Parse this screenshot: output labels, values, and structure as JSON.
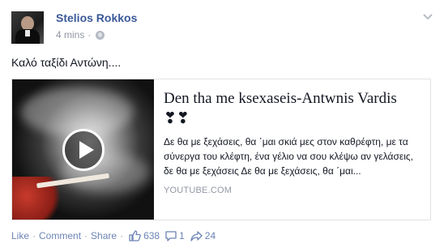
{
  "post": {
    "author": "Stelios Rokkos",
    "timestamp": "4 mins",
    "separator": "·",
    "privacy_icon": "globe-icon",
    "message": "Καλό ταξίδι Αντώνη....",
    "share": {
      "title": "Den tha me ksexaseis-Antwnis Vardis ❣❣",
      "description": "Δε θα με ξεχάσεις, θα ΄μαι σκιά μες στον καθρέφτη, με τα σύνεργα του κλέφτη, ένα γέλιο να σου κλέψω αν γελάσεις, δε θα με ξεχάσεις Δε θα με ξεχάσεις, θα ΄μαι...",
      "source": "YOUTUBE.COM"
    },
    "actions": {
      "like": "Like",
      "comment": "Comment",
      "share": "Share",
      "dot": "·",
      "likes_count": "638",
      "comments_count": "1",
      "shares_count": "24"
    }
  }
}
